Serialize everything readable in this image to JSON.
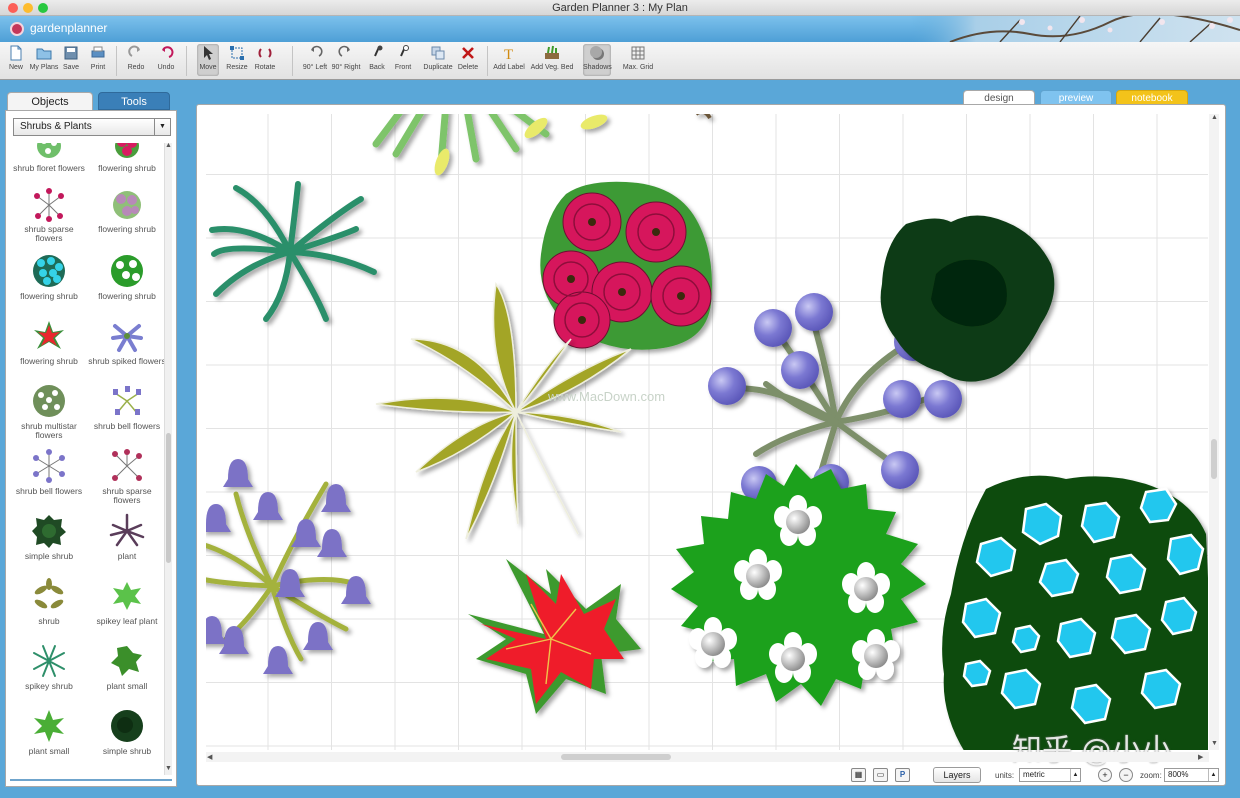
{
  "window": {
    "title": "Garden Planner 3 : My  Plan"
  },
  "brand": {
    "name": "gardenplanner"
  },
  "toolbar": {
    "buttons": [
      {
        "label": "New",
        "icon": "new-document-icon"
      },
      {
        "label": "My Plans",
        "icon": "folder-icon"
      },
      {
        "label": "Save",
        "icon": "save-icon"
      },
      {
        "label": "Print",
        "icon": "print-icon"
      },
      {
        "label": "Redo",
        "icon": "redo-icon"
      },
      {
        "label": "Undo",
        "icon": "undo-icon"
      },
      {
        "label": "Move",
        "icon": "pointer-icon"
      },
      {
        "label": "Resize",
        "icon": "resize-icon"
      },
      {
        "label": "Rotate",
        "icon": "rotate-icon"
      },
      {
        "label": "90° Left",
        "icon": "rotate-left-icon"
      },
      {
        "label": "90° Right",
        "icon": "rotate-right-icon"
      },
      {
        "label": "Back",
        "icon": "send-back-icon"
      },
      {
        "label": "Front",
        "icon": "bring-front-icon"
      },
      {
        "label": "Duplicate",
        "icon": "duplicate-icon"
      },
      {
        "label": "Delete",
        "icon": "delete-icon"
      },
      {
        "label": "Add Label",
        "icon": "text-label-icon"
      },
      {
        "label": "Add Veg. Bed",
        "icon": "veg-bed-icon"
      },
      {
        "label": "Shadows",
        "icon": "shadows-icon"
      },
      {
        "label": "Max. Grid",
        "icon": "grid-icon"
      }
    ]
  },
  "panel": {
    "tabs": [
      "Objects",
      "Tools"
    ],
    "category": "Shrubs & Plants",
    "items": [
      "shrub floret flowers",
      "flowering shrub",
      "shrub sparse flowers",
      "flowering shrub",
      "flowering shrub",
      "flowering shrub",
      "flowering shrub",
      "shrub spiked flowers",
      "shrub multistar flowers",
      "shrub bell flowers",
      "shrub bell flowers",
      "shrub sparse flowers",
      "simple shrub",
      "plant",
      "shrub",
      "spikey leaf plant",
      "spikey shrub",
      "plant small",
      "plant small",
      "simple shrub"
    ]
  },
  "views": {
    "design": "design",
    "preview": "preview",
    "notebook": "notebook"
  },
  "status": {
    "layers": "Layers",
    "units_label": "units:",
    "units_value": "metric",
    "zoom_label": "zoom:",
    "zoom_value": "800%"
  },
  "watermark": {
    "site": "www.MacDown.com",
    "overlay": "知乎 @小小"
  },
  "colors": {
    "accent": "#3a7fb8",
    "brand": "#5aa7d8",
    "notebook": "#f3c31a"
  }
}
